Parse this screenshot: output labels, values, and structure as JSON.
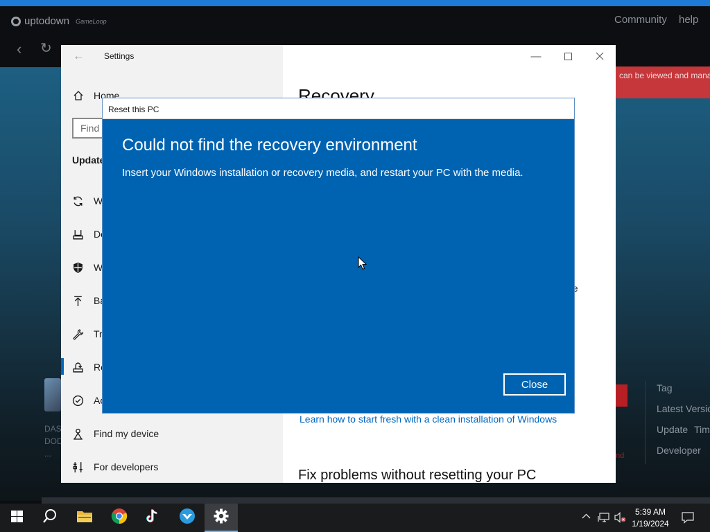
{
  "background": {
    "logo_text": "uptodown",
    "logo_suffix": "GameLoop",
    "links": [
      "Community",
      "help"
    ],
    "red_banner": "can be viewed and mana",
    "app_name_lines": [
      "DAS",
      "DOD",
      "..."
    ],
    "info_labels": [
      "Tag",
      "Latest Versio",
      "Update",
      "Tim",
      "Developer"
    ],
    "red_note": "nd"
  },
  "settings": {
    "title": "Settings",
    "nav": {
      "home": "Home",
      "search_placeholder": "Find",
      "section": "Update",
      "items": [
        {
          "label": "W",
          "icon": "sync-icon"
        },
        {
          "label": "De",
          "icon": "delivery-icon"
        },
        {
          "label": "W",
          "icon": "shield-icon"
        },
        {
          "label": "Ba",
          "icon": "backup-icon"
        },
        {
          "label": "Tr",
          "icon": "wrench-icon"
        },
        {
          "label": "Re",
          "icon": "recovery-icon"
        },
        {
          "label": "Ac",
          "icon": "check-circle-icon"
        },
        {
          "label": "Find my device",
          "icon": "person-icon"
        },
        {
          "label": "For developers",
          "icon": "developer-icon"
        }
      ]
    },
    "main": {
      "title": "Recovery",
      "trunc_1": "ge",
      "trunc_2": "r",
      "learn_link": "Learn how to start fresh with a clean installation of Windows",
      "fix_heading": "Fix problems without resetting your PC"
    }
  },
  "dialog": {
    "title": "Reset this PC",
    "heading": "Could not find the recovery environment",
    "message": "Insert your Windows installation or recovery media, and restart your PC with the media.",
    "close_label": "Close"
  },
  "taskbar": {
    "apps": [
      "windows-start-icon",
      "search-icon",
      "file-explorer-icon",
      "chrome-icon",
      "tiktok-icon",
      "app-icon",
      "settings-icon"
    ],
    "time": "5:39 AM",
    "date": "1/19/2024"
  },
  "colors": {
    "dialog_bg": "#0063b1",
    "accent": "#0067c0",
    "taskbar": "#1a1b1d"
  }
}
